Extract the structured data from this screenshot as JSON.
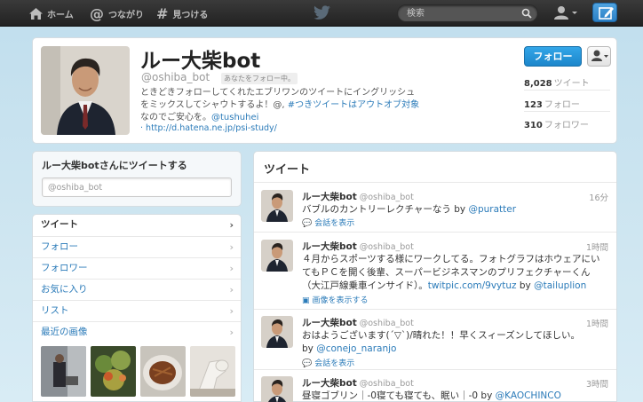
{
  "topnav": {
    "home": "ホーム",
    "connect": "つながり",
    "discover": "見つける",
    "search_placeholder": "検索"
  },
  "profile": {
    "name": "ルー大柴bot",
    "handle": "@oshiba_bot",
    "follows_you": "あなたをフォロー中。",
    "bio_line1": "ときどきフォローしてくれたエブリワンのツイートにイングリッシュ",
    "bio_line2_pre": "をミックスしてシャウトするよ！@, ",
    "bio_line2_tag": "#つきツイートはアウトオブ対象",
    "bio_line3_pre": "なのでご安心を。",
    "bio_line3_mention": "@tushuhei",
    "url": "http://d.hatena.ne.jp/psi-study/",
    "follow_button": "フォロー",
    "stats": [
      {
        "value": "8,028",
        "label": "ツイート"
      },
      {
        "value": "123",
        "label": "フォロー"
      },
      {
        "value": "310",
        "label": "フォロワー"
      }
    ]
  },
  "tweetbox": {
    "title": "ルー大柴botさんにツイートする",
    "value": "@oshiba_bot"
  },
  "sidenav": {
    "items": [
      {
        "label": "ツイート"
      },
      {
        "label": "フォロー"
      },
      {
        "label": "フォロワー"
      },
      {
        "label": "お気に入り"
      },
      {
        "label": "リスト"
      },
      {
        "label": "最近の画像"
      }
    ]
  },
  "timeline": {
    "title": "ツイート",
    "tweets": [
      {
        "name": "ルー大柴bot",
        "handle": "@oshiba_bot",
        "time": "16分",
        "text_pre": "バブルのカントリーレクチャーなう by ",
        "text_link": "@puratter",
        "action": "会話を表示"
      },
      {
        "name": "ルー大柴bot",
        "handle": "@oshiba_bot",
        "time": "1時間",
        "line1": "４月からスポーツする様にワークしてる。フォトグラフはホウェアにい",
        "line2": "てもＰＣを開く後輩、スーパービジネスマンのプリフェクチャーくん",
        "line3_pre": "（大江戸線乗車インサイド）。",
        "line3_link1": "twitpic.com/9vytuz",
        "line3_mid": " by ",
        "line3_link2": "@tailuplion",
        "action": "画像を表示する"
      },
      {
        "name": "ルー大柴bot",
        "handle": "@oshiba_bot",
        "time": "1時間",
        "line1": "おはようございます(´▽`)/晴れた！！早くスィーズンしてほしい。",
        "line2_pre": "by ",
        "line2_link": "@conejo_naranjo",
        "action": "会話を表示"
      },
      {
        "name": "ルー大柴bot",
        "handle": "@oshiba_bot",
        "time": "3時間",
        "text_pre": "昼寝ゴブリン｜-0寝ても寝ても、眠い｜-0 by ",
        "text_link": "@KAOCHINCO"
      }
    ]
  },
  "colors": {
    "accent": "#2b7bb9",
    "follow_button": "#1c86cb",
    "topbar": "#2a2a2a",
    "background": "#c0deed"
  }
}
